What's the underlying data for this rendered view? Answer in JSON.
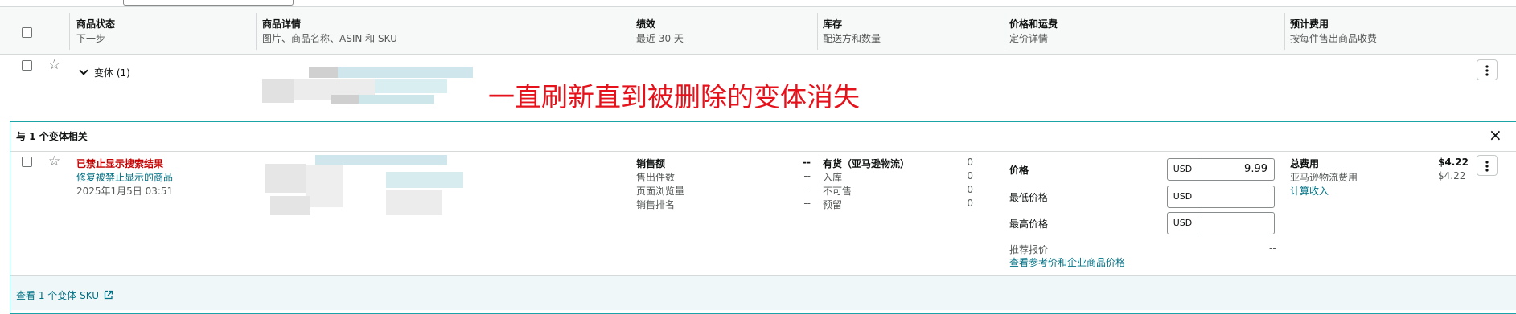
{
  "header": {
    "columns": [
      {
        "title": "商品状态",
        "sub": "下一步"
      },
      {
        "title": "商品详情",
        "sub": "图片、商品名称、ASIN 和 SKU"
      },
      {
        "title": "绩效",
        "sub": "最近 30 天"
      },
      {
        "title": "库存",
        "sub": "配送方和数量"
      },
      {
        "title": "价格和运费",
        "sub": "定价详情"
      },
      {
        "title": "预计费用",
        "sub": "按每件售出商品收费"
      }
    ]
  },
  "parent_row": {
    "variant_toggle": "变体 (1)",
    "annotation": "一直刷新直到被删除的变体消失"
  },
  "variants_panel": {
    "title": "与 1 个变体相关",
    "close": "×",
    "status": {
      "warning": "已禁止显示搜索结果",
      "fix_link": "修复被禁止显示的商品",
      "date": "2025年1月5日 03:51"
    },
    "performance": [
      {
        "label": "销售额",
        "value": "--"
      },
      {
        "label": "售出件数",
        "value": "--"
      },
      {
        "label": "页面浏览量",
        "value": "--"
      },
      {
        "label": "销售排名",
        "value": "--"
      }
    ],
    "inventory": [
      {
        "label": "有货（亚马逊物流）",
        "value": "0"
      },
      {
        "label": "入库",
        "value": "0"
      },
      {
        "label": "不可售",
        "value": "0"
      },
      {
        "label": "预留",
        "value": "0"
      }
    ],
    "pricing": {
      "price_label": "价格",
      "currency": "USD",
      "price_value": "9.99",
      "min_label": "最低价格",
      "max_label": "最高价格",
      "recommended_label": "推荐报价",
      "recommended_value": "--",
      "reference_link": "查看参考价和企业商品价格"
    },
    "fees": {
      "total_label": "总费用",
      "total_value": "$4.22",
      "fba_label": "亚马逊物流费用",
      "fba_value": "$4.22",
      "calc_link": "计算收入"
    },
    "footer_link": "查看 1 个变体 SKU"
  },
  "colors": {
    "teal_border": "#1ba3a8",
    "annotation_red": "#e5121b",
    "warning_red": "#c40000",
    "link": "#007185"
  }
}
